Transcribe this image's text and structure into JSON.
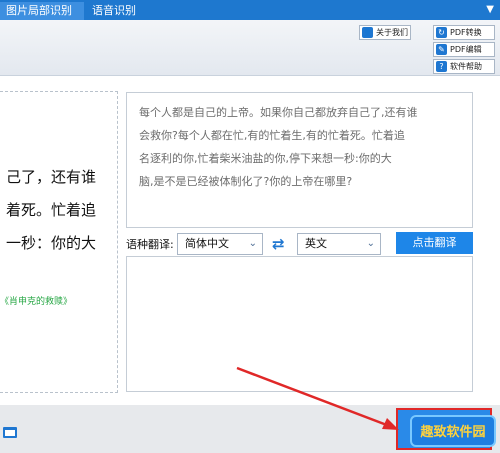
{
  "tabs": [
    {
      "label": "图片局部识别"
    },
    {
      "label": "语音识别"
    }
  ],
  "toolbar": {
    "about_label": "关于我们",
    "pdf_convert_label": "PDF转换",
    "pdf_edit_label": "PDF编辑",
    "help_label": "软件帮助"
  },
  "left_panel": {
    "lines": [
      "己了，还有谁",
      "着死。忙着追",
      "一秒：你的大"
    ],
    "link": "《肖申克的救赎》"
  },
  "ocr_text": {
    "lines": [
      "每个人都是自己的上帝。如果你自己都放弃自己了,还有谁",
      "会救你?每个人都在忙,有的忙着生,有的忙着死。忙着追",
      "名逐利的你,忙着柴米油盐的你,停下来想一秒:你的大",
      "脑,是不是已经被体制化了?你的上帝在哪里?"
    ]
  },
  "translate": {
    "label": "语种翻译:",
    "source": "简体中文",
    "target": "英文",
    "button": "点击翻译"
  },
  "watermark": "趣致软件园",
  "colors": {
    "accent": "#1e78cf",
    "annotation": "#e02828"
  }
}
